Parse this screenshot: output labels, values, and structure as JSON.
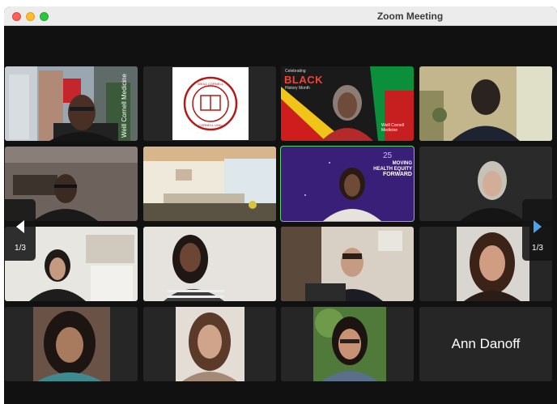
{
  "window": {
    "title": "Zoom Meeting"
  },
  "pager": {
    "left_page": "1/3",
    "right_page": "1/3"
  },
  "tiles": {
    "weill_watermark": "Weill Cornell Medicine",
    "seal_text": "WEILL CORNELL MEDICAL COLLEGE · CORNELL UNIVERSITY",
    "bhm": {
      "celebrating": "Celebrating",
      "black": "BLACK",
      "month": "History Month",
      "brand": "Weill Cornell Medicine"
    },
    "banner": {
      "number": "25",
      "line1": "MOVING",
      "line2": "HEALTH EQUITY",
      "line3": "FORWARD"
    },
    "ann_name": "Ann Danoff"
  },
  "colors": {
    "active_outline": "#62d36a",
    "nav_arrow": "#4aa3ea",
    "window_bg": "#111111"
  }
}
